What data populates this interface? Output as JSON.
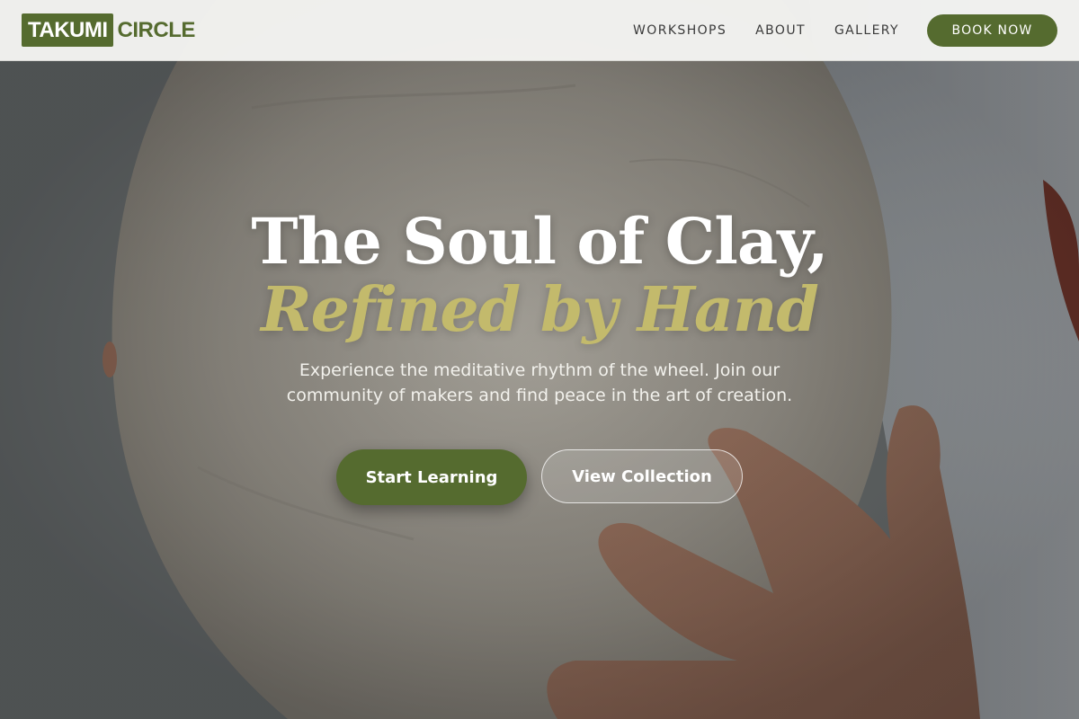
{
  "brand": {
    "name_boxed": "TAKUMI",
    "name_plain": "CIRCLE"
  },
  "nav": {
    "links": [
      "WORKSHOPS",
      "ABOUT",
      "GALLERY"
    ],
    "cta_label": "BOOK NOW"
  },
  "hero": {
    "title_line1": "The Soul of Clay,",
    "title_line2": "Refined by Hand",
    "subtitle": "Experience the meditative rhythm of the wheel. Join our community of makers and find peace in the art of creation.",
    "primary_button": "Start Learning",
    "secondary_button": "View Collection",
    "background_image": "person-holding-clay-vessel-photo"
  },
  "colors": {
    "brand_green": "#556b2f",
    "accent_gold": "#c3ba6c",
    "nav_background": "#f5f5f3"
  }
}
